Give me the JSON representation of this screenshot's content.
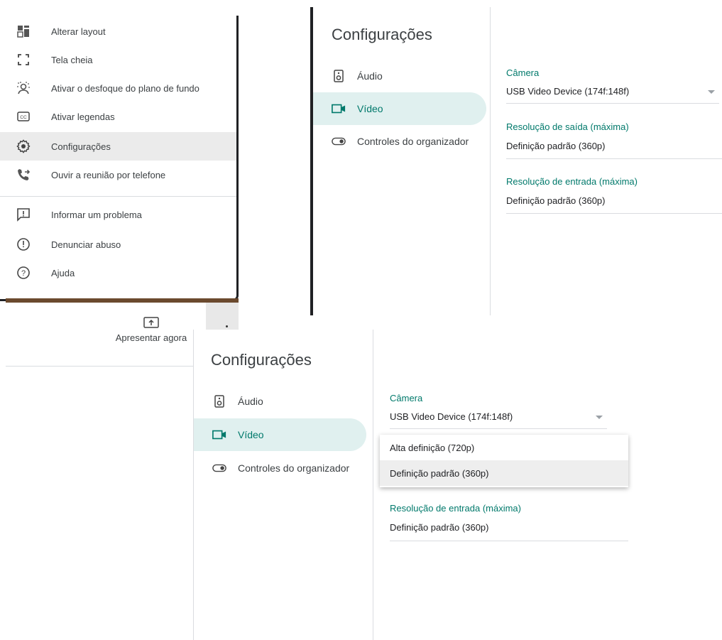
{
  "menu": {
    "items": [
      {
        "label": "Alterar layout",
        "icon": "layout-icon"
      },
      {
        "label": "Tela cheia",
        "icon": "fullscreen-icon"
      },
      {
        "label": "Ativar o desfoque do plano de fundo",
        "icon": "blur-background-icon"
      },
      {
        "label": "Ativar legendas",
        "icon": "captions-icon"
      },
      {
        "label": "Configurações",
        "icon": "gear-icon"
      },
      {
        "label": "Ouvir a reunião por telefone",
        "icon": "phone-forward-icon"
      },
      {
        "label": "Informar um problema",
        "icon": "report-problem-icon"
      },
      {
        "label": "Denunciar abuso",
        "icon": "alert-circle-icon"
      },
      {
        "label": "Ajuda",
        "icon": "help-icon"
      }
    ],
    "active_index": 4
  },
  "present": {
    "label": "Apresentar agora"
  },
  "settings_top": {
    "title": "Configurações",
    "nav": [
      {
        "label": "Áudio",
        "icon": "speaker-icon"
      },
      {
        "label": "Vídeo",
        "icon": "video-camera-icon"
      },
      {
        "label": "Controles do organizador",
        "icon": "toggle-icon"
      }
    ],
    "camera_label": "Câmera",
    "camera_value": "USB Video Device (174f:148f)",
    "out_res_label": "Resolução de saída (máxima)",
    "out_res_value": "Definição padrão (360p)",
    "in_res_label": "Resolução de entrada (máxima)",
    "in_res_value": "Definição padrão (360p)"
  },
  "settings_bottom": {
    "title": "Configurações",
    "nav": [
      {
        "label": "Áudio",
        "icon": "speaker-icon"
      },
      {
        "label": "Vídeo",
        "icon": "video-camera-icon"
      },
      {
        "label": "Controles do organizador",
        "icon": "toggle-icon"
      }
    ],
    "camera_label": "Câmera",
    "camera_value": "USB Video Device (174f:148f)",
    "dropdown_options": [
      "Alta definição (720p)",
      "Definição padrão (360p)"
    ],
    "dropdown_selected_index": 1,
    "in_res_label": "Resolução de entrada (máxima)",
    "in_res_value": "Definição padrão (360p)"
  },
  "colors": {
    "accent": "#00796b",
    "nav_active_bg": "#e0f0ef",
    "menu_active_bg": "#ebebeb"
  }
}
